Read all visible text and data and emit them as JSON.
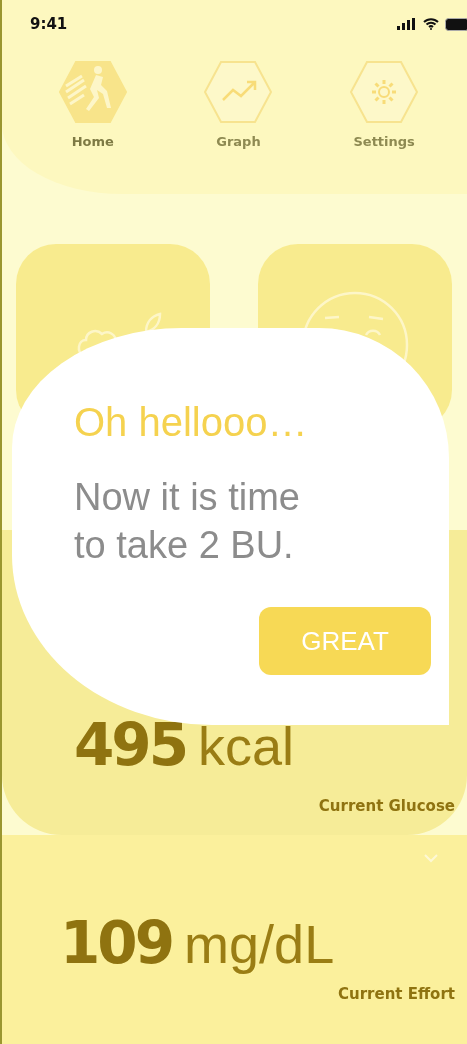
{
  "status_bar": {
    "time": "9:41"
  },
  "tabs": [
    {
      "label": "Home",
      "selected": true
    },
    {
      "label": "Graph",
      "selected": false
    },
    {
      "label": "Settings",
      "selected": false
    }
  ],
  "cards": [
    {
      "kind": "food"
    },
    {
      "kind": "mood"
    }
  ],
  "readings": [
    {
      "value": "495",
      "unit": "kcal",
      "label": "Current Glucose"
    },
    {
      "value": "109",
      "unit": "mg/dL",
      "label": "Current Effort"
    }
  ],
  "dialog": {
    "title": "Oh hellooo…",
    "message": "Now it is time to take 2 BU.",
    "button": "GREAT"
  }
}
